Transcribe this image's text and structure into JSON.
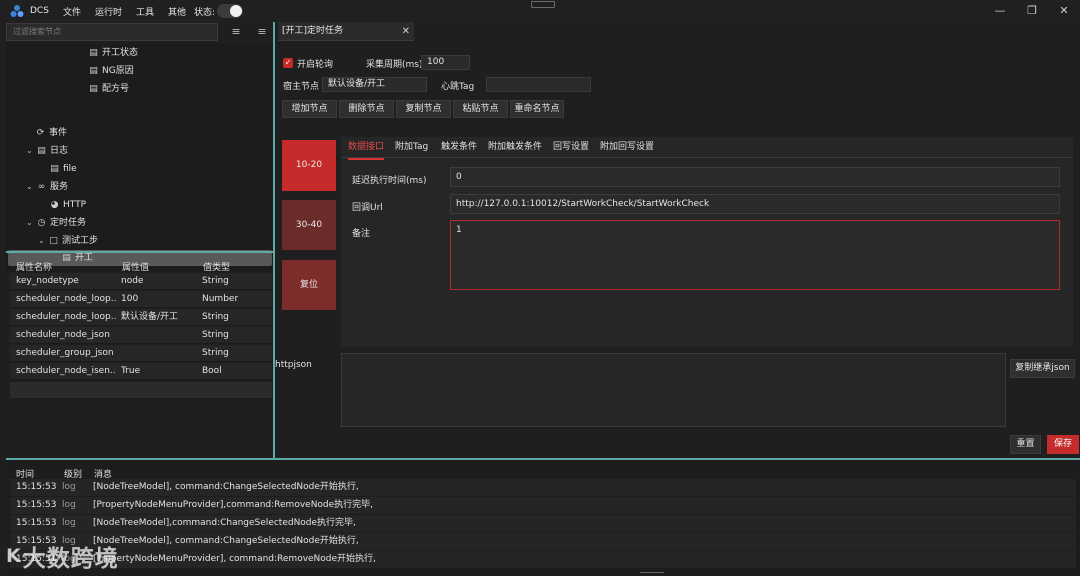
{
  "titlebar": {
    "app_name": "DCS",
    "menu": [
      "文件",
      "运行时",
      "工具",
      "其他"
    ],
    "status_label": "状态:",
    "status_toggle": "on",
    "icons": {
      "logo": "app-logo-icon",
      "minimize": "minimize-icon",
      "maximize": "maximize-icon",
      "close": "close-icon"
    }
  },
  "left": {
    "search_placeholder": "过滤搜索节点",
    "tree": [
      {
        "label": "开工状态",
        "icon": "document-icon"
      },
      {
        "label": "NG原因",
        "icon": "document-icon"
      },
      {
        "label": "配方号",
        "icon": "document-icon"
      },
      {
        "label": "事件",
        "icon": "bolt-icon"
      },
      {
        "label": "日志",
        "icon": "log-icon"
      },
      {
        "label": "file",
        "icon": "file-icon"
      },
      {
        "label": "服务",
        "icon": "link-icon"
      },
      {
        "label": "HTTP",
        "icon": "globe-icon"
      },
      {
        "label": "定时任务",
        "icon": "clock-icon"
      },
      {
        "label": "测试工步",
        "icon": "folder-icon"
      },
      {
        "label": "开工",
        "icon": "document-icon"
      }
    ],
    "props": {
      "headers": [
        "属性名称",
        "属性值",
        "值类型"
      ],
      "rows": [
        [
          "key_nodetype",
          "node",
          "String"
        ],
        [
          "scheduler_node_loop...",
          "100",
          "Number"
        ],
        [
          "scheduler_node_loop...",
          "默认设备/开工",
          "String"
        ],
        [
          "scheduler_node_json",
          "",
          "String"
        ],
        [
          "scheduler_group_json",
          "",
          "String"
        ],
        [
          "scheduler_node_isen...",
          "True",
          "Bool"
        ]
      ]
    }
  },
  "right": {
    "tab_title": "[开工]定时任务",
    "enable_label": "开启轮询",
    "period_label": "采集周期(ms)",
    "period_value": "100",
    "host_label": "宿主节点",
    "host_value": "默认设备/开工",
    "heartbeat_label": "心跳Tag",
    "heartbeat_value": "",
    "buttons": [
      "增加节点",
      "删除节点",
      "复制节点",
      "粘贴节点",
      "重命名节点"
    ],
    "side_blocks": [
      {
        "label": "10-20",
        "color": "#c62b2b"
      },
      {
        "label": "30-40",
        "color": "#6b2b2b"
      },
      {
        "label": "复位",
        "color": "#7e2b2b"
      }
    ],
    "detail_tabs": [
      "数据接口",
      "附加Tag",
      "触发条件",
      "附加触发条件",
      "回写设置",
      "附加回写设置"
    ],
    "active_tab": 0,
    "delay_label": "延迟执行时间(ms)",
    "delay_value": "0",
    "callback_label": "回调Url",
    "callback_value": "http://127.0.0.1:10012/StartWorkCheck/StartWorkCheck",
    "note_label": "备注",
    "note_value": "1",
    "httpjson_label": "httpjson",
    "copy_json_button": "复制继承json",
    "reset_button": "重置",
    "save_button": "保存",
    "accent_color": "#c42b2b"
  },
  "log": {
    "headers": [
      "时间",
      "级别",
      "消息"
    ],
    "rows": [
      [
        "15:15:53",
        "log",
        "[NodeTreeModel], command:ChangeSelectedNode开始执行,"
      ],
      [
        "15:15:53",
        "log",
        "[PropertyNodeMenuProvider],command:RemoveNode执行完毕,"
      ],
      [
        "15:15:53",
        "log",
        "[NodeTreeModel],command:ChangeSelectedNode执行完毕,"
      ],
      [
        "15:15:53",
        "log",
        "[NodeTreeModel], command:ChangeSelectedNode开始执行,"
      ],
      [
        "15:15:51",
        "log",
        "[PropertyNodeMenuProvider], command:RemoveNode开始执行,"
      ]
    ]
  },
  "watermark": {
    "mark": "K",
    "text": "大数跨境"
  }
}
